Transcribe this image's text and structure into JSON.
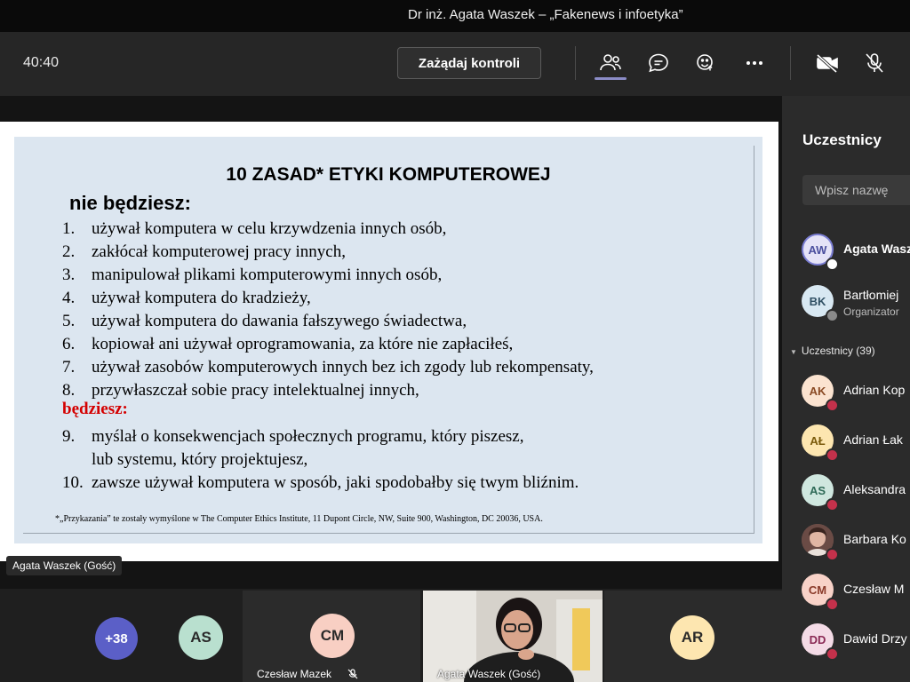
{
  "window": {
    "title": "Dr inż. Agata Waszek – „Fakenews i infoetyka”"
  },
  "toolbar": {
    "timer": "40:40",
    "request_control_label": "Zażądaj kontroli",
    "icons": [
      "people-icon",
      "chat-icon",
      "reactions-icon",
      "more-icon",
      "camera-off-icon",
      "mic-off-icon"
    ]
  },
  "slide": {
    "title": "10 ZASAD* ETYKI KOMPUTEROWEJ",
    "subtitle": "nie będziesz:",
    "rules_not": [
      {
        "num": "1.",
        "text": "używał komputera w celu krzywdzenia innych osób,"
      },
      {
        "num": "2.",
        "text": "zakłócał komputerowej pracy innych,"
      },
      {
        "num": "3.",
        "text": "manipulował plikami komputerowymi innych osób,"
      },
      {
        "num": "4.",
        "text": "używał komputera do kradzieży,"
      },
      {
        "num": "5.",
        "text": "używał komputera do dawania fałszywego świadectwa,"
      },
      {
        "num": "6.",
        "text": "kopiował ani używał oprogramowania, za które nie zapłaciłeś,"
      },
      {
        "num": "7.",
        "text": "używał zasobów komputerowych innych bez ich zgody lub rekompensaty,"
      },
      {
        "num": "8.",
        "text": "przywłaszczał sobie pracy intelektualnej innych,"
      }
    ],
    "positive_heading": "będziesz:",
    "rule9_num": "9.",
    "rule9_line1": "myślał o konsekwencjach społecznych programu, który piszesz,",
    "rule9_line2": "lub systemu, który projektujesz,",
    "rule10_num": "10.",
    "rule10_text": "zawsze używał komputera w sposób, jaki spodobałby się twym bliźnim.",
    "footnote": "*„Przykazania” te zostały wymyślone w The Computer Ethics Institute, 11 Dupont Circle, NW, Suite 900, Washington, DC 20036, USA."
  },
  "presenter_label": "Agata Waszek (Gość)",
  "gallery": {
    "more_count": "+38",
    "tiles": [
      {
        "initials": "AS",
        "color": "#b9e0cf"
      },
      {
        "initials": "CM",
        "name": "Czesław Mazek",
        "color": "#f8cfc3"
      },
      {
        "name": "Agata Waszek (Gość)"
      },
      {
        "initials": "AR",
        "color": "#fde6b0"
      }
    ]
  },
  "participants_panel": {
    "title": "Uczestnicy",
    "search_placeholder": "Wpisz nazwę",
    "organizers": [
      {
        "initials": "AW",
        "name": "Agata Waszek",
        "color": "#e5e3f7"
      },
      {
        "initials": "BK",
        "name": "Bartłomiej",
        "role": "Organizator",
        "color": "#d8e8f2"
      }
    ],
    "section_label": "Uczestnicy (39)",
    "attendees": [
      {
        "initials": "AK",
        "name": "Adrian Kop",
        "color": "#fbe3d0"
      },
      {
        "initials": "AŁ",
        "name": "Adrian Łak",
        "color": "#fde6b0"
      },
      {
        "initials": "AS",
        "name": "Aleksandra",
        "color": "#cfe7df"
      },
      {
        "initials": "",
        "name": "Barbara Ko",
        "color": "#7a5a52"
      },
      {
        "initials": "CM",
        "name": "Czesław M",
        "color": "#f8d2c8"
      },
      {
        "initials": "DD",
        "name": "Dawid Drzy",
        "color": "#f4dbe6"
      }
    ]
  },
  "colors": {
    "accent": "#8b8cc7",
    "busy": "#c4314b",
    "slide_bg": "#dce6f0",
    "red_heading": "#d40000"
  }
}
